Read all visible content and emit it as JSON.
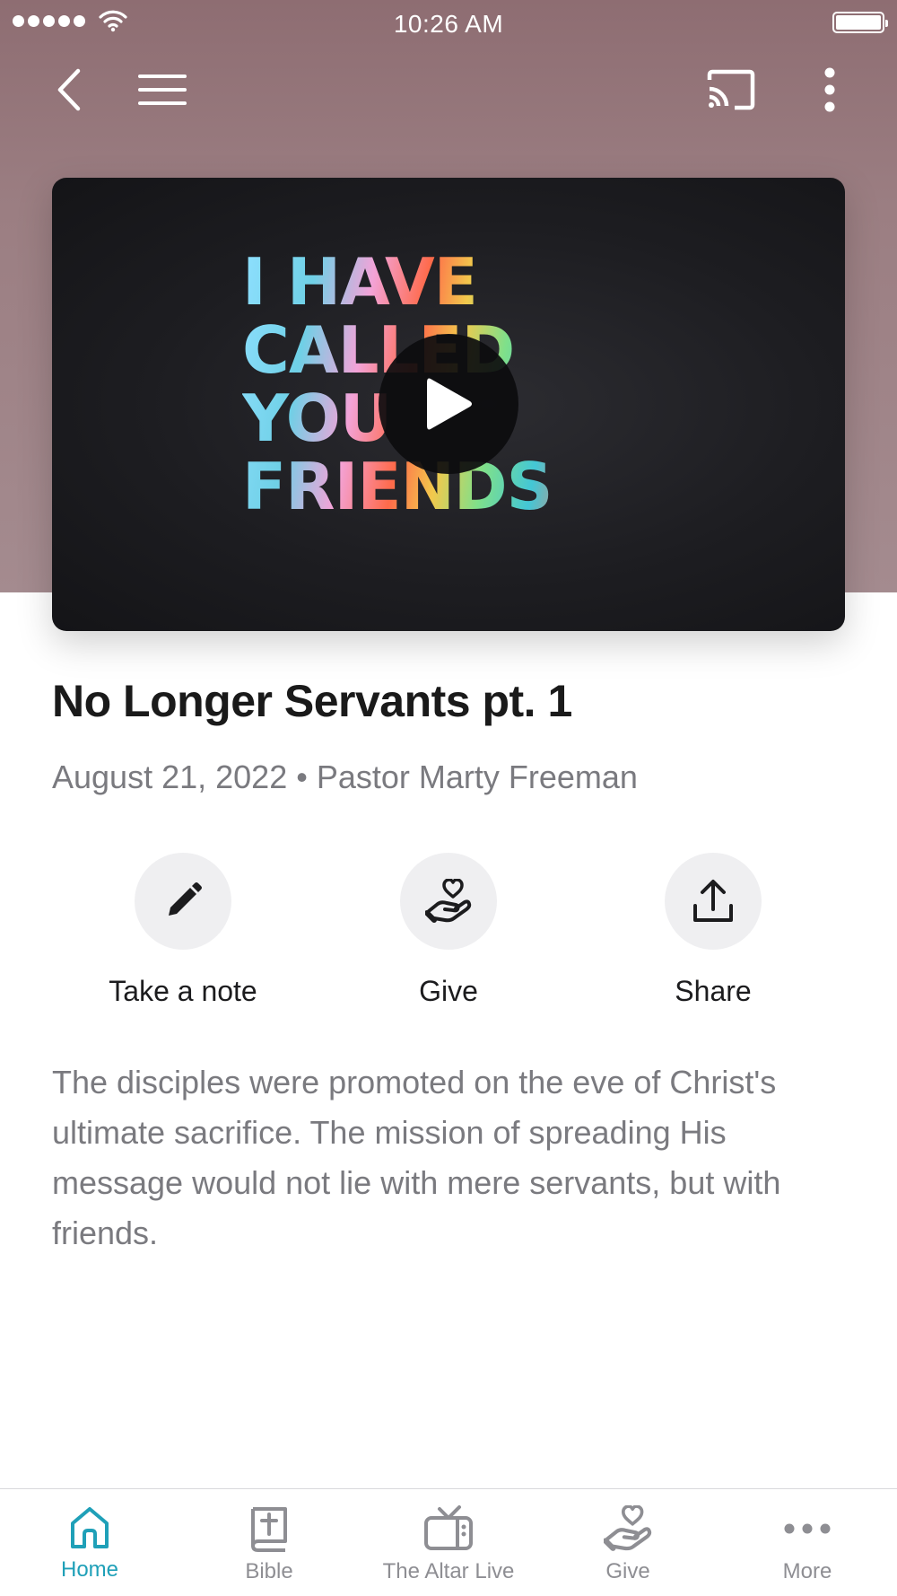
{
  "status_bar": {
    "time": "10:26 AM",
    "signal_bars": 5,
    "battery_level": 1.0
  },
  "nav": {
    "back_icon": "chevron-left-icon",
    "menu_icon": "hamburger-menu-icon",
    "cast_icon": "cast-icon",
    "more_icon": "vertical-dots-icon"
  },
  "video": {
    "artwork_lines": [
      "I HAVE",
      "CALLED",
      "YOU",
      "FRIENDS"
    ],
    "play_icon": "play-icon"
  },
  "sermon": {
    "title": "No Longer Servants pt. 1",
    "meta": "August 21, 2022 • Pastor Marty Freeman",
    "description": "The disciples were promoted on the eve of Christ's ultimate sacrifice. The mission of spreading His message would not lie with mere servants, but with friends."
  },
  "actions": [
    {
      "label": "Take a note",
      "icon": "pencil-icon"
    },
    {
      "label": "Give",
      "icon": "hand-heart-icon"
    },
    {
      "label": "Share",
      "icon": "share-upload-icon"
    }
  ],
  "tabs": [
    {
      "label": "Home",
      "icon": "home-icon",
      "active": true
    },
    {
      "label": "Bible",
      "icon": "bible-icon",
      "active": false
    },
    {
      "label": "The Altar Live",
      "icon": "tv-icon",
      "active": false
    },
    {
      "label": "Give",
      "icon": "hand-heart-icon",
      "active": false
    },
    {
      "label": "More",
      "icon": "more-dots-icon",
      "active": false
    }
  ],
  "colors": {
    "header_bg": "#9b7e82",
    "accent": "#1fa0b8",
    "tab_inactive": "#8e8e93",
    "action_circle": "#efeff1",
    "secondary_text": "#7a7a7f"
  }
}
